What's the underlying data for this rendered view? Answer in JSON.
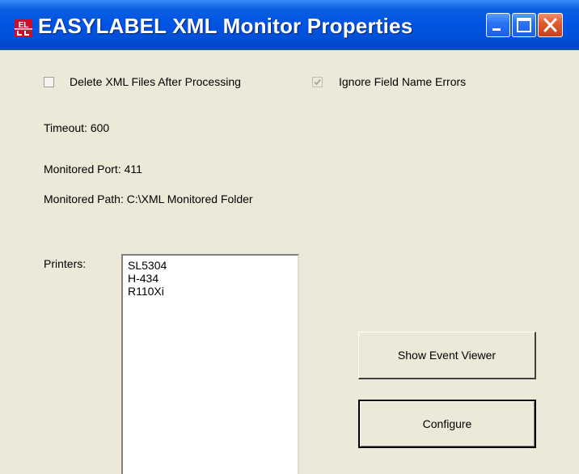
{
  "window": {
    "title": "EASYLABEL XML Monitor Properties",
    "icon_text": "EL",
    "titlebar_color": "#0054e3",
    "face_color": "#ece9d8"
  },
  "titlebar_buttons": {
    "minimize": "minimize-icon",
    "maximize": "maximize-icon",
    "close": "close-icon"
  },
  "options": {
    "delete_xml": {
      "label": "Delete XML Files After Processing",
      "checked": false,
      "enabled": true
    },
    "ignore_field_errors": {
      "label": "Ignore Field Name Errors",
      "checked": true,
      "enabled": false
    }
  },
  "info": {
    "timeout": "Timeout: 600",
    "monitored_port": "Monitored Port: 411",
    "monitored_path": "Monitored Path:  C:\\XML Monitored Folder"
  },
  "printers": {
    "label": "Printers:",
    "items": [
      "SL5304",
      "H-434",
      "R110Xi"
    ]
  },
  "buttons": {
    "show_event_viewer": "Show Event Viewer",
    "configure": "Configure"
  }
}
